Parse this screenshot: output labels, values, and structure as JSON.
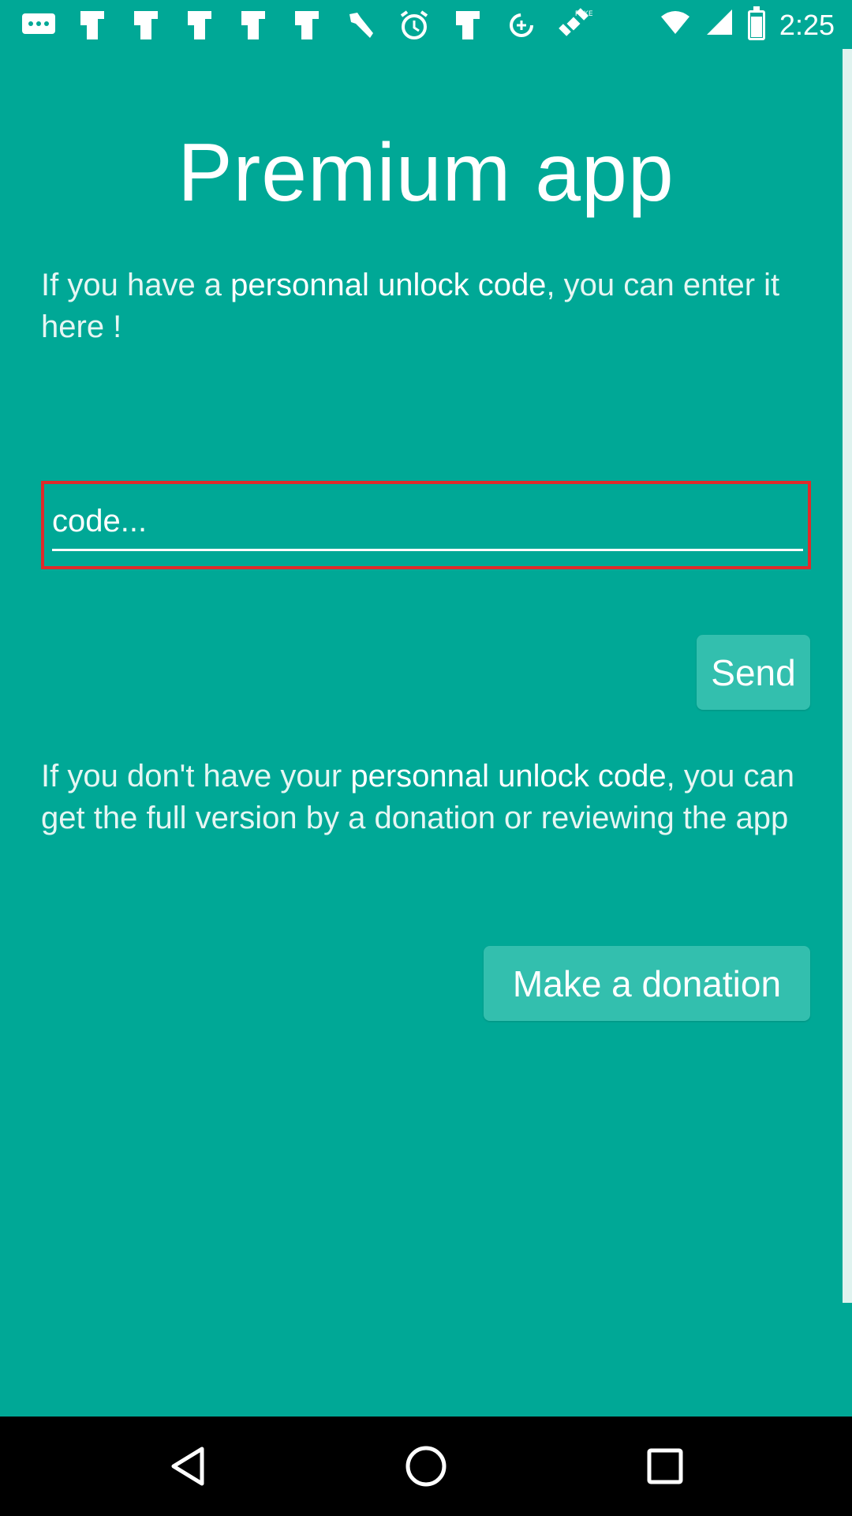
{
  "status_bar": {
    "time": "2:25",
    "icons": [
      "chat-icon",
      "sim-icon",
      "sim-icon",
      "sim-icon",
      "sim-icon",
      "sim-icon",
      "wrench-icon",
      "alarm-icon",
      "sim-icon",
      "data-saver-icon",
      "satellite-icon",
      "wifi-icon",
      "cellular-icon",
      "battery-icon"
    ]
  },
  "page": {
    "title": "Premium app",
    "para1": {
      "before": "If you have a ",
      "bold": "personnal unlock code",
      "after": ", you can enter it here !"
    },
    "code_input": {
      "placeholder": "code...",
      "value": ""
    },
    "send_button": "Send",
    "para2": {
      "before": "If you don't have your ",
      "bold": "personnal unlock code",
      "after": ", you can get the full version by a donation or reviewing the app"
    },
    "donate_button": "Make a donation"
  },
  "nav": {
    "back": "back-icon",
    "home": "home-icon",
    "recent": "recent-apps-icon"
  },
  "colors": {
    "background": "#00a896",
    "button": "#33bfae",
    "highlight": "#e02a2a"
  }
}
